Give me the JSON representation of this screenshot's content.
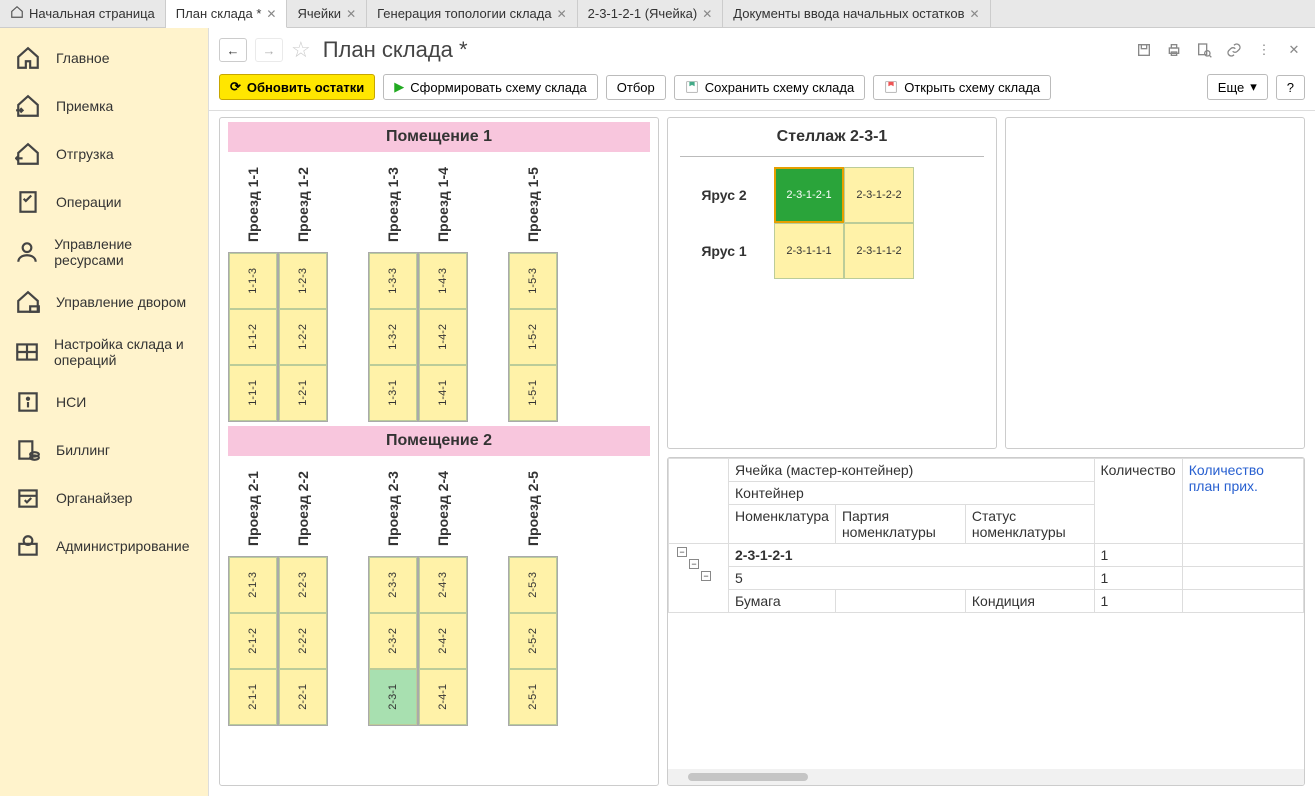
{
  "tabs": {
    "home": "Начальная страница",
    "items": [
      "План склада *",
      "Ячейки",
      "Генерация топологии склада",
      "2-3-1-2-1 (Ячейка)",
      "Документы ввода начальных остатков"
    ]
  },
  "sidebar": [
    "Главное",
    "Приемка",
    "Отгрузка",
    "Операции",
    "Управление ресурсами",
    "Управление двором",
    "Настройка склада и операций",
    "НСИ",
    "Биллинг",
    "Органайзер",
    "Администрирование"
  ],
  "header": {
    "title": "План склада *"
  },
  "toolbar": {
    "refresh": "Обновить остатки",
    "build": "Сформировать схему склада",
    "filter": "Отбор",
    "save": "Сохранить схему склада",
    "open": "Открыть схему склада",
    "more": "Еще",
    "help": "?"
  },
  "rooms": [
    {
      "title": "Помещение 1",
      "groups": [
        {
          "aisles": [
            {
              "label": "Проезд 1-1",
              "cells": [
                "1-1-3",
                "1-1-2",
                "1-1-1"
              ]
            },
            {
              "label": "Проезд 1-2",
              "cells": [
                "1-2-3",
                "1-2-2",
                "1-2-1"
              ]
            }
          ]
        },
        {
          "aisles": [
            {
              "label": "Проезд 1-3",
              "cells": [
                "1-3-3",
                "1-3-2",
                "1-3-1"
              ]
            },
            {
              "label": "Проезд 1-4",
              "cells": [
                "1-4-3",
                "1-4-2",
                "1-4-1"
              ]
            }
          ]
        },
        {
          "aisles": [
            {
              "label": "Проезд 1-5",
              "cells": [
                "1-5-3",
                "1-5-2",
                "1-5-1"
              ]
            }
          ]
        }
      ]
    },
    {
      "title": "Помещение 2",
      "groups": [
        {
          "aisles": [
            {
              "label": "Проезд 2-1",
              "cells": [
                "2-1-3",
                "2-1-2",
                "2-1-1"
              ]
            },
            {
              "label": "Проезд 2-2",
              "cells": [
                "2-2-3",
                "2-2-2",
                "2-2-1"
              ]
            }
          ]
        },
        {
          "aisles": [
            {
              "label": "Проезд 2-3",
              "cells": [
                "2-3-3",
                "2-3-2",
                "2-3-1"
              ],
              "selected": "2-3-1"
            },
            {
              "label": "Проезд 2-4",
              "cells": [
                "2-4-3",
                "2-4-2",
                "2-4-1"
              ]
            }
          ]
        },
        {
          "aisles": [
            {
              "label": "Проезд 2-5",
              "cells": [
                "2-5-3",
                "2-5-2",
                "2-5-1"
              ]
            }
          ]
        }
      ]
    }
  ],
  "rack": {
    "title": "Стеллаж 2-3-1",
    "tiers": [
      {
        "label": "Ярус 2",
        "cells": [
          {
            "v": "2-3-1-2-1",
            "sel": true
          },
          {
            "v": "2-3-1-2-2"
          }
        ]
      },
      {
        "label": "Ярус 1",
        "cells": [
          {
            "v": "2-3-1-1-1"
          },
          {
            "v": "2-3-1-1-2"
          }
        ]
      }
    ]
  },
  "table": {
    "headers": {
      "cell": "Ячейка (мастер-контейнер)",
      "qty": "Количество",
      "qty_plan": "Количество план прих.",
      "container": "Контейнер",
      "nomen": "Номенклатура",
      "batch": "Партия номенклатуры",
      "status": "Статус номенклатуры"
    },
    "rows": [
      {
        "cell": "2-3-1-2-1",
        "qty": "1",
        "bold": true
      },
      {
        "cell": "5",
        "qty": "1",
        "pad": 1
      },
      {
        "cell": "Бумага",
        "status": "Кондиция",
        "qty": "1",
        "pad": 2
      }
    ]
  }
}
